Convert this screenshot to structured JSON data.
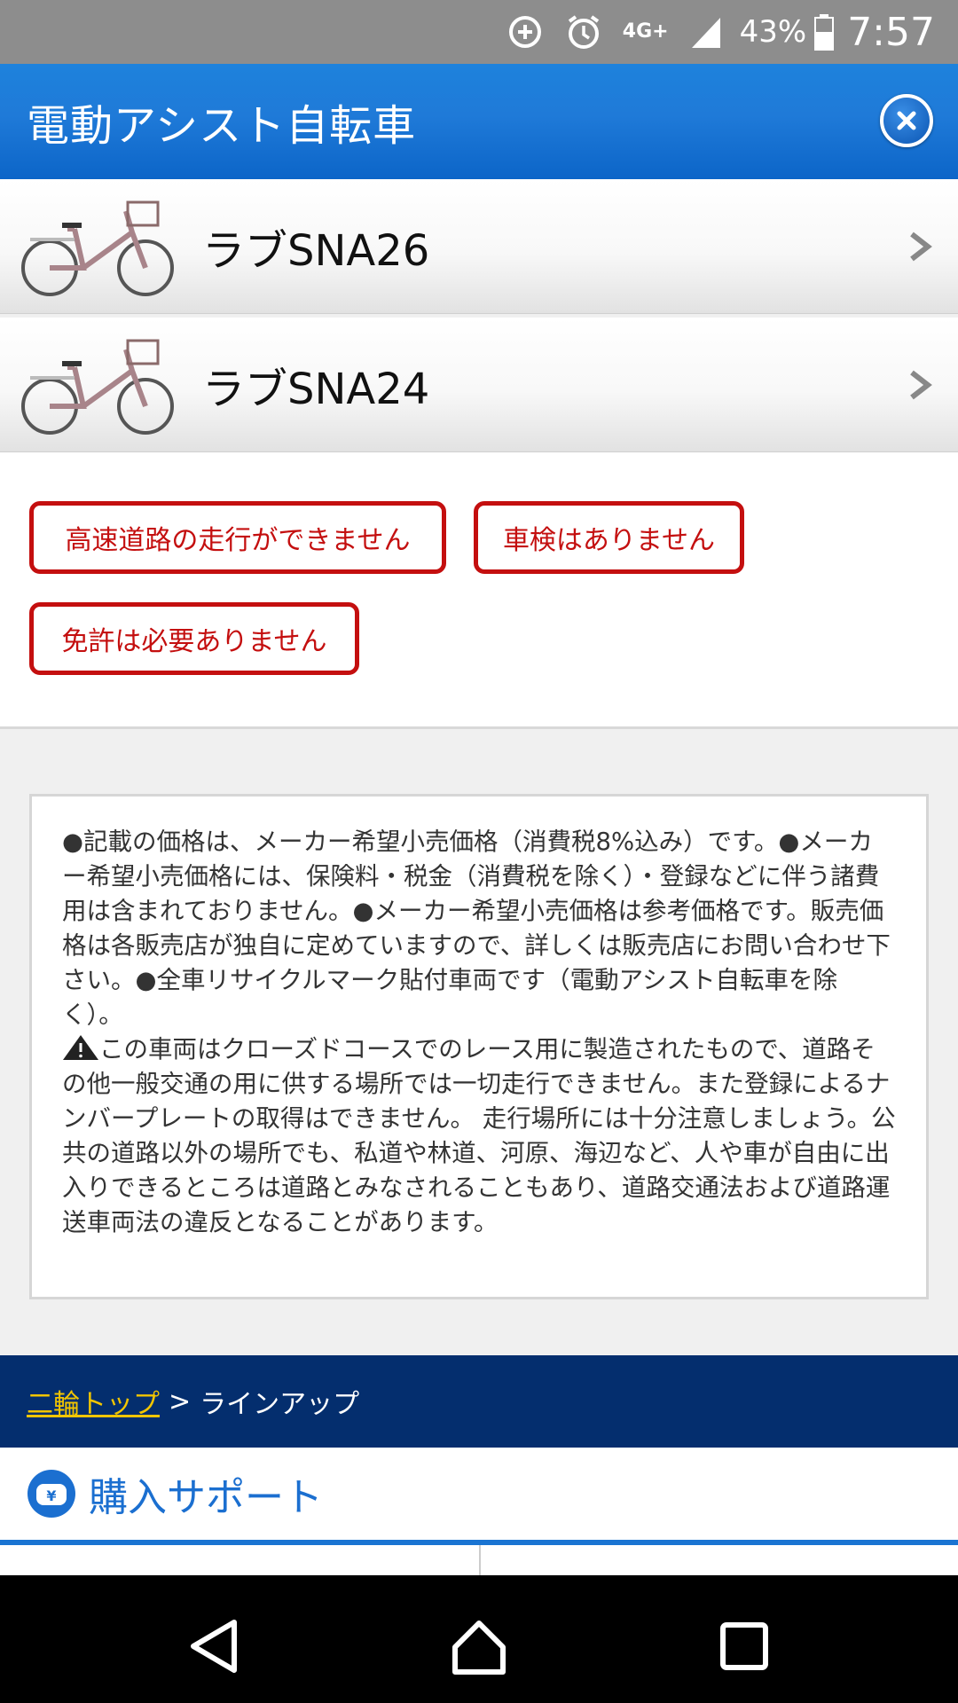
{
  "status_bar": {
    "network": "4G+",
    "battery": "43%",
    "time": "7:57"
  },
  "header": {
    "title": "電動アシスト自転車"
  },
  "products": [
    {
      "name": "ラブSNA26"
    },
    {
      "name": "ラブSNA24"
    }
  ],
  "tags": [
    "高速道路の走行ができません",
    "車検はありません",
    "免許は必要ありません"
  ],
  "notice": {
    "paragraph1": "●記載の価格は、メーカー希望小売価格（消費税8%込み）です。●メーカー希望小売価格には、保険料・税金（消費税を除く）・登録などに伴う諸費用は含まれておりません。●メーカー希望小売価格は参考価格です。販売価格は各販売店が独自に定めていますので、詳しくは販売店にお問い合わせ下さい。●全車リサイクルマーク貼付車両です（電動アシスト自転車を除く）。",
    "paragraph2": "この車両はクローズドコースでのレース用に製造されたもので、道路その他一般交通の用に供する場所では一切走行できません。また登録によるナンバープレートの取得はできません。 走行場所には十分注意しましょう。公共の道路以外の場所でも、私道や林道、河原、海辺など、人や車が自由に出入りできるところは道路とみなされることもあり、道路交通法および道路運送車両法の違反となることがあります。"
  },
  "breadcrumb": {
    "link": "二輪トップ",
    "separator": ">",
    "current": "ラインアップ"
  },
  "support": {
    "title": "購入サポート"
  },
  "colors": {
    "header_blue": "#1f7ad8",
    "tag_red": "#c40f0f",
    "breadcrumb_bg": "#042e6e",
    "breadcrumb_link": "#f2c500",
    "support_blue": "#1b6fd0"
  }
}
